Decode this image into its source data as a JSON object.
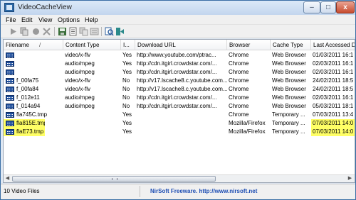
{
  "window": {
    "title": "VideoCacheView",
    "min_glyph": "–",
    "max_glyph": "□",
    "close_glyph": "x"
  },
  "menu": [
    "File",
    "Edit",
    "View",
    "Options",
    "Help"
  ],
  "toolbar": {
    "buttons": [
      {
        "icon": "play-icon",
        "color": "#9a9a9a"
      },
      {
        "icon": "copy-files-icon",
        "color": "#9a9a9a"
      },
      {
        "icon": "record-icon",
        "color": "#9a9a9a"
      },
      {
        "icon": "delete-icon",
        "color": "#9a9a9a"
      },
      {
        "icon": "save-icon",
        "color": "#3a6f3a"
      },
      {
        "icon": "html-report-icon",
        "color": "#6b6b6b"
      },
      {
        "icon": "copy-icon",
        "color": "#9a9a9a"
      },
      {
        "icon": "properties-icon",
        "color": "#9a9a9a"
      },
      {
        "icon": "find-icon",
        "color": "#2e5f9e"
      },
      {
        "icon": "exit-icon",
        "color": "#2a8a8a"
      }
    ]
  },
  "columns": [
    "Filename",
    "Content Type",
    "I...",
    "Download URL",
    "Browser",
    "Cache Type",
    "Last Accessed D"
  ],
  "sort_indicator": "/",
  "rows": [
    {
      "filename": "",
      "content_type": "video/x-flv",
      "in_cache": "Yes",
      "url": "http://www.youtube.com/ptrac...",
      "browser": "Chrome",
      "cache_type": "Web Browser",
      "last_accessed": "01/03/2011 16:1",
      "highlighted": false
    },
    {
      "filename": "",
      "content_type": "audio/mpeg",
      "in_cache": "Yes",
      "url": "http://cdn.itgirl.crowdstar.com/...",
      "browser": "Chrome",
      "cache_type": "Web Browser",
      "last_accessed": "02/03/2011 16:1",
      "highlighted": false
    },
    {
      "filename": "",
      "content_type": "audio/mpeg",
      "in_cache": "Yes",
      "url": "http://cdn.itgirl.crowdstar.com/...",
      "browser": "Chrome",
      "cache_type": "Web Browser",
      "last_accessed": "02/03/2011 16:1",
      "highlighted": false
    },
    {
      "filename": "f_00fa75",
      "content_type": "video/x-flv",
      "in_cache": "No",
      "url": "http://v17.lscache8.c.youtube.com...",
      "browser": "Chrome",
      "cache_type": "Web Browser",
      "last_accessed": "24/02/2011 18:5",
      "highlighted": false
    },
    {
      "filename": "f_00fa84",
      "content_type": "video/x-flv",
      "in_cache": "No",
      "url": "http://v17.lscache8.c.youtube.com...",
      "browser": "Chrome",
      "cache_type": "Web Browser",
      "last_accessed": "24/02/2011 18:5",
      "highlighted": false
    },
    {
      "filename": "f_012e11",
      "content_type": "audio/mpeg",
      "in_cache": "No",
      "url": "http://cdn.itgirl.crowdstar.com/...",
      "browser": "Chrome",
      "cache_type": "Web Browser",
      "last_accessed": "02/03/2011 16:1",
      "highlighted": false
    },
    {
      "filename": "f_014a94",
      "content_type": "audio/mpeg",
      "in_cache": "No",
      "url": "http://cdn.itgirl.crowdstar.com/...",
      "browser": "Chrome",
      "cache_type": "Web Browser",
      "last_accessed": "05/03/2011 18:1",
      "highlighted": false
    },
    {
      "filename": "fla745C.tmp",
      "content_type": "",
      "in_cache": "Yes",
      "url": "",
      "browser": "Chrome",
      "cache_type": "Temporary ...",
      "last_accessed": "07/03/2011 13:4",
      "highlighted": false
    },
    {
      "filename": "fla815E.tmp",
      "content_type": "",
      "in_cache": "Yes",
      "url": "",
      "browser": "Mozilla/Firefox",
      "cache_type": "Temporary ...",
      "last_accessed": "07/03/2011 14:0",
      "highlighted": true
    },
    {
      "filename": "flaE73.tmp",
      "content_type": "",
      "in_cache": "Yes",
      "url": "",
      "browser": "Mozilla/Firefox",
      "cache_type": "Temporary ...",
      "last_accessed": "07/03/2011 14:0",
      "highlighted": true
    }
  ],
  "colors": {
    "highlight": "#ffff66",
    "link": "#1f4fb4",
    "title_bar": "#c3d6ee"
  },
  "scrollbar": {
    "left_arrow": "◀",
    "right_arrow": "▶"
  },
  "status": {
    "left": "10 Video Files",
    "right": "NirSoft Freeware.  http://www.nirsoft.net"
  }
}
